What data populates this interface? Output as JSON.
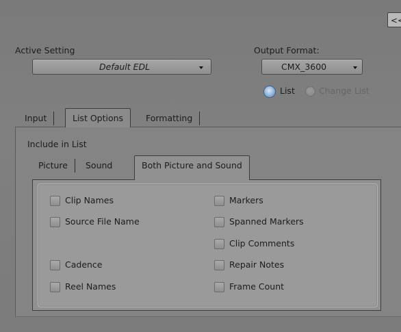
{
  "corner_button": "<<",
  "active_setting": {
    "label": "Active Setting",
    "value": "Default EDL"
  },
  "output_format": {
    "label": "Output Format:",
    "value": "CMX_3600"
  },
  "list_mode": {
    "options": [
      "List",
      "Change List"
    ],
    "selected": "List"
  },
  "tabs": [
    "Input",
    "List Options",
    "Formatting"
  ],
  "selected_tab": "List Options",
  "include_label": "Include in List",
  "sub_tabs": [
    "Picture",
    "Sound",
    "Both Picture and Sound"
  ],
  "selected_sub_tab": "Both Picture and Sound",
  "checkboxes_left": [
    "Clip Names",
    "Source File Name",
    "Cadence",
    "Reel Names"
  ],
  "checkboxes_right": [
    "Markers",
    "Spanned Markers",
    "Clip Comments",
    "Repair Notes",
    "Frame Count"
  ]
}
